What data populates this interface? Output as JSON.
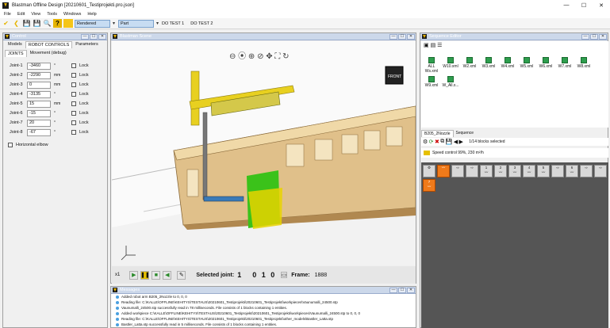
{
  "window": {
    "title": "Blastman Offline Design [20210601_Testiprojekti.pro.json]",
    "minimize": "—",
    "maximize": "☐",
    "close": "✕"
  },
  "menu": [
    "File",
    "Edit",
    "View",
    "Tools",
    "Windows",
    "Help"
  ],
  "toolbar": {
    "render_mode": "Rendered",
    "object": "Part",
    "do_test1": "DO TEST 1",
    "do_test2": "DO TEST 2"
  },
  "control": {
    "title": "Control",
    "tabs": [
      "Models",
      "ROBOT CONTROLS",
      "Parameters"
    ],
    "subtabs": [
      "JOINTS",
      "Movement (debug)"
    ],
    "joints": [
      {
        "label": "Joint-1",
        "value": "-3460",
        "unit": "°",
        "lock": "Lock"
      },
      {
        "label": "Joint-2",
        "value": "-2290",
        "unit": "mm",
        "lock": "Lock"
      },
      {
        "label": "Joint-3",
        "value": "0",
        "unit": "mm",
        "lock": "Lock"
      },
      {
        "label": "Joint-4",
        "value": "-3135",
        "unit": "°",
        "lock": "Lock"
      },
      {
        "label": "Joint-5",
        "value": "15",
        "unit": "mm",
        "lock": "Lock"
      },
      {
        "label": "Joint-6",
        "value": "-15",
        "unit": "°",
        "lock": "Lock"
      },
      {
        "label": "Joint-7",
        "value": "20",
        "unit": "°",
        "lock": "Lock"
      },
      {
        "label": "Joint-8",
        "value": "-67",
        "unit": "°",
        "lock": "Lock"
      }
    ],
    "horizontal_elbow": "Horizontal elbow"
  },
  "scene": {
    "title": "Blastman Scene",
    "speed_label": "x1",
    "selected_joint_label": "Selected joint:",
    "selected_joint": "1",
    "joint_flags": "0 1 0",
    "frame_label": "Frame:",
    "frame": "1888",
    "cube_label": "FRONT"
  },
  "messages": {
    "title": "Messages",
    "lines": [
      "Added robot arm B205_2Nozzle to 0, 0, 0",
      "Reading file: C:\\KALLE\\OFFLINE\\KEHITYS\\TESTAUS\\20210601_Testiprojekti\\20210601_Testiprojekti\\workpieces\\Vaunumalli_24500.stp",
      "Vaunumalli_24500.stp successfully read in 78 milliseconds. File consists of 1 blocks containing 1 entities.",
      "Added workpiece C:\\KALLE\\OFFLINE\\KEHITYS\\TESTAUS\\20210601_Testiprojekti\\20210601_Testiprojekti\\workpieces\\Vaunumalli_24500.stp to 0, 0, 0",
      "Reading file: C:\\KALLE\\OFFLINE\\KEHITYS\\TESTAUS\\20210601_Testiprojekti\\20210601_Testiprojekti\\other_models\\Bastler_Latta.stp",
      "Bastler_Latta.stp successfully read in 5 milliseconds. File consists of 1 blocks containing 1 entities."
    ]
  },
  "sequence": {
    "title": "Sequence Editor",
    "files": [
      "ALL Ws.xml",
      "W10.xml",
      "W2.xml",
      "W3.xml",
      "W4.xml",
      "W5.xml",
      "W6.xml",
      "W7.xml",
      "W8.xml",
      "W9.xml",
      "W_All.x..."
    ],
    "tabs": [
      "B205_2Nozzle",
      "Sequence"
    ],
    "blocks_selected": "1/14 blocks selected",
    "speed_control": "Speed control 99%, 230 m²/h",
    "block_numbers": [
      "1",
      "2",
      "3",
      "4",
      "5",
      "6",
      "7"
    ]
  }
}
